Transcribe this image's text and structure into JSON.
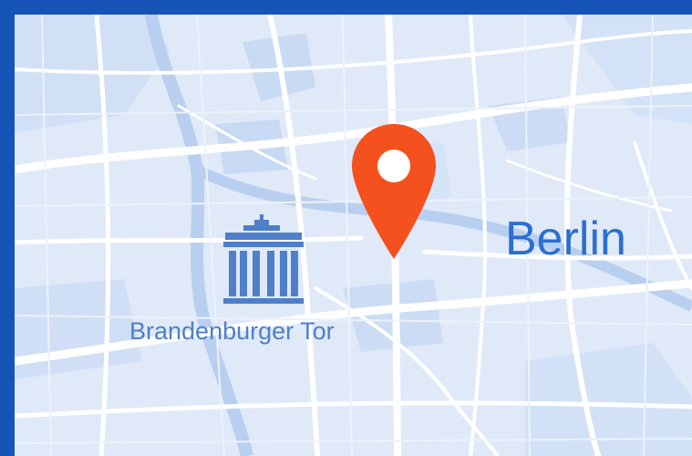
{
  "map": {
    "city_label": "Berlin",
    "landmark_label": "Brandenburger Tor",
    "landmark_icon": "brandenburg-gate-icon",
    "pin_icon": "location-pin-icon",
    "colors": {
      "frame": "#1654b8",
      "land": "#dfe9f8",
      "roads": "#ffffff",
      "blocks": "#c9daf3",
      "city_text": "#2c6fcf",
      "landmark": "#4f7fc9",
      "pin": "#f4511e"
    }
  }
}
